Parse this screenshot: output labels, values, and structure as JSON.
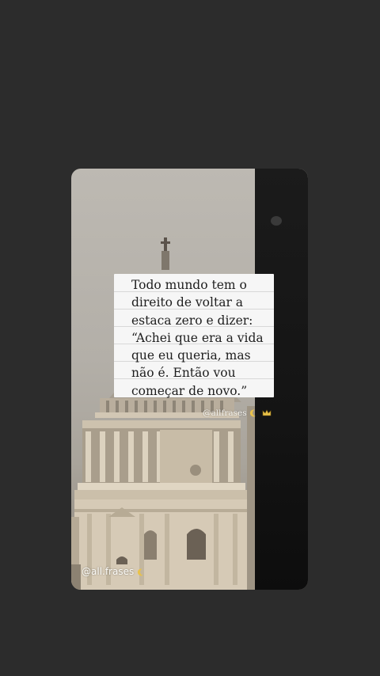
{
  "quote": {
    "lines": [
      "Todo mundo tem o",
      "direito de voltar a",
      "estaca zero e dizer:",
      "“Achei que era a vida",
      "que eu queria, mas",
      "não é. Então vou",
      "começar de novo.”"
    ]
  },
  "watermarks": {
    "top_handle": "@allfrases",
    "bottom_handle": "@all.frases"
  },
  "icons": {
    "moon": "crescent-moon-icon",
    "crown": "crown-icon"
  },
  "colors": {
    "background": "#2c2c2c",
    "sky": "#b7b3ac",
    "stone": "#c9bfb0",
    "accent_gold": "#e9c24a"
  }
}
